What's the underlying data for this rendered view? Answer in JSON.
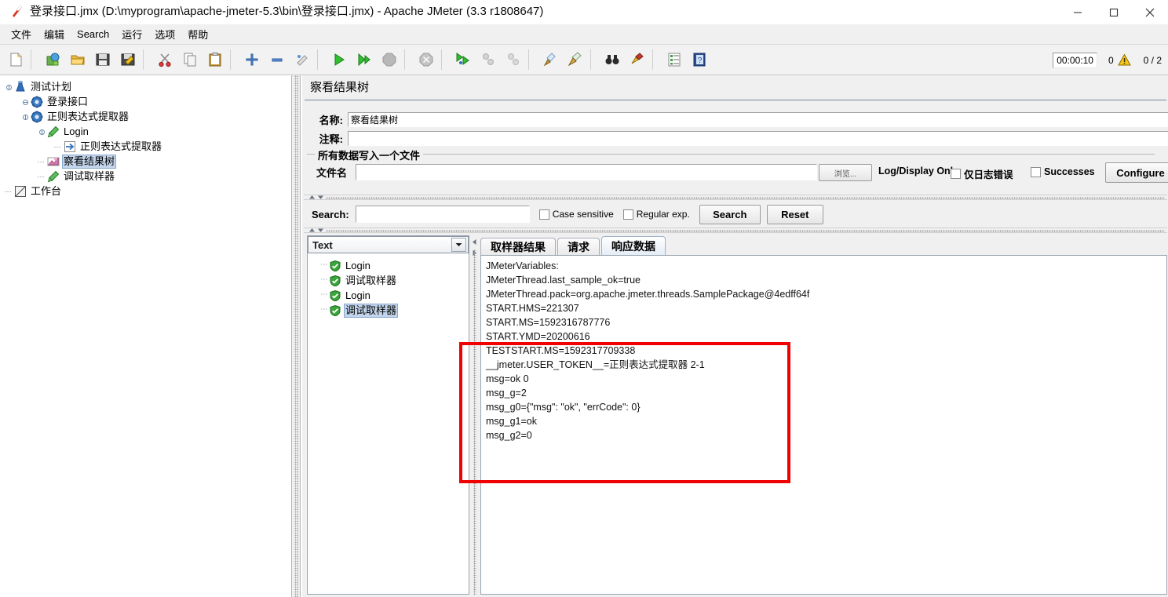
{
  "window": {
    "title": "登录接口.jmx (D:\\myprogram\\apache-jmeter-5.3\\bin\\登录接口.jmx) - Apache JMeter (3.3 r1808647)",
    "minimize_label": "—",
    "maximize_label": "□",
    "close_label": "✕",
    "app_icon": "jmeter-feather-icon"
  },
  "menu": {
    "items": [
      {
        "label": "文件",
        "name": "menu-file"
      },
      {
        "label": "编辑",
        "name": "menu-edit"
      },
      {
        "label": "Search",
        "name": "menu-search"
      },
      {
        "label": "运行",
        "name": "menu-run"
      },
      {
        "label": "选项",
        "name": "menu-options"
      },
      {
        "label": "帮助",
        "name": "menu-help"
      }
    ]
  },
  "toolbar": {
    "buttons": [
      {
        "icon": "new-document-icon",
        "name": "toolbar-new"
      },
      {
        "icon": "templates-icon",
        "name": "toolbar-templates"
      },
      {
        "icon": "open-folder-icon",
        "name": "toolbar-open"
      },
      {
        "icon": "save-icon",
        "name": "toolbar-save"
      },
      {
        "icon": "save-as-icon",
        "name": "toolbar-save-as"
      },
      {
        "icon": "cut-scissors-icon",
        "name": "toolbar-cut"
      },
      {
        "icon": "copy-icon",
        "name": "toolbar-copy"
      },
      {
        "icon": "paste-clipboard-icon",
        "name": "toolbar-paste"
      },
      {
        "icon": "expand-plus-icon",
        "name": "toolbar-expand-all"
      },
      {
        "icon": "collapse-minus-icon",
        "name": "toolbar-collapse-all"
      },
      {
        "icon": "toggle-icon",
        "name": "toolbar-toggle"
      },
      {
        "icon": "start-play-icon",
        "name": "toolbar-start"
      },
      {
        "icon": "start-no-timers-icon",
        "name": "toolbar-start-no-pauses"
      },
      {
        "icon": "stop-icon",
        "name": "toolbar-stop"
      },
      {
        "icon": "shutdown-icon",
        "name": "toolbar-shutdown"
      },
      {
        "icon": "remote-start-all-icon",
        "name": "toolbar-remote-start-all"
      },
      {
        "icon": "remote-stop-all-icon",
        "name": "toolbar-remote-stop-all"
      },
      {
        "icon": "remote-shutdown-all-icon",
        "name": "toolbar-remote-shutdown-all"
      },
      {
        "icon": "clear-broom-icon",
        "name": "toolbar-clear"
      },
      {
        "icon": "clear-all-broom-icon",
        "name": "toolbar-clear-all"
      },
      {
        "icon": "search-binoculars-icon",
        "name": "toolbar-search"
      },
      {
        "icon": "reset-search-brush-icon",
        "name": "toolbar-reset-search"
      },
      {
        "icon": "function-helper-icon",
        "name": "toolbar-function-helper"
      },
      {
        "icon": "help-book-icon",
        "name": "toolbar-help"
      }
    ],
    "status": {
      "timer": "00:00:10",
      "warning_count": "0",
      "warning_icon": "warning-triangle-icon",
      "thread_count": "0 / 2"
    }
  },
  "tree": {
    "nodes": [
      {
        "label": "测试计划",
        "icon": "test-plan-icon",
        "depth": 0,
        "handle": "expanded",
        "selected": false,
        "name": "tree-node-test-plan"
      },
      {
        "label": "登录接口",
        "icon": "thread-group-icon",
        "depth": 1,
        "handle": "collapsed",
        "selected": false,
        "name": "tree-node-login-interface"
      },
      {
        "label": "正则表达式提取器",
        "icon": "thread-group-icon",
        "depth": 1,
        "handle": "expanded",
        "selected": false,
        "name": "tree-node-regex-extractor-group"
      },
      {
        "label": "Login",
        "icon": "sampler-icon",
        "depth": 2,
        "handle": "expanded",
        "selected": false,
        "name": "tree-node-login-sampler"
      },
      {
        "label": "正则表达式提取器",
        "icon": "post-processor-icon",
        "depth": 3,
        "handle": "none",
        "selected": false,
        "name": "tree-node-regex-extractor"
      },
      {
        "label": "察看结果树",
        "icon": "view-results-tree-icon",
        "depth": 2,
        "handle": "none",
        "selected": true,
        "name": "tree-node-view-results-tree"
      },
      {
        "label": "调试取样器",
        "icon": "sampler-icon",
        "depth": 2,
        "handle": "none",
        "selected": false,
        "name": "tree-node-debug-sampler"
      },
      {
        "label": "工作台",
        "icon": "workbench-icon",
        "depth": 0,
        "handle": "none",
        "selected": false,
        "name": "tree-node-workbench"
      }
    ]
  },
  "panel": {
    "header": "察看结果树",
    "name_label": "名称:",
    "name_value": "察看结果树",
    "comment_label": "注释:",
    "comment_value": "",
    "groupbox_title": "所有数据写入一个文件",
    "filename_label": "文件名",
    "filename_value": "",
    "browse_label": "浏览...",
    "log_display_label": "Log/Display Only:",
    "errors_only_label": "仅日志错误",
    "successes_label": "Successes",
    "configure_label": "Configure"
  },
  "search": {
    "label": "Search:",
    "value": "",
    "case_sensitive_label": "Case sensitive",
    "regular_exp_label": "Regular exp.",
    "search_button": "Search",
    "reset_button": "Reset"
  },
  "results": {
    "render_selector": "Text",
    "items": [
      {
        "label": "Login",
        "status": "success",
        "selected": false,
        "name": "result-item-login-1"
      },
      {
        "label": "调试取样器",
        "status": "success",
        "selected": false,
        "name": "result-item-debug-1"
      },
      {
        "label": "Login",
        "status": "success",
        "selected": false,
        "name": "result-item-login-2"
      },
      {
        "label": "调试取样器",
        "status": "success",
        "selected": true,
        "name": "result-item-debug-2"
      }
    ]
  },
  "tabs": [
    {
      "label": "取样器结果",
      "active": false,
      "name": "tab-sampler-result"
    },
    {
      "label": "请求",
      "active": false,
      "name": "tab-request"
    },
    {
      "label": "响应数据",
      "active": true,
      "name": "tab-response-data"
    }
  ],
  "response_data": {
    "lines": [
      "JMeterVariables:",
      "JMeterThread.last_sample_ok=true",
      "JMeterThread.pack=org.apache.jmeter.threads.SamplePackage@4edff64f",
      "START.HMS=221307",
      "START.MS=1592316787776",
      "START.YMD=20200616",
      "TESTSTART.MS=1592317709338",
      "__jmeter.USER_TOKEN__=正则表达式提取器 2-1",
      "msg=ok 0",
      "msg_g=2",
      "msg_g0={\"msg\": \"ok\", \"errCode\": 0}",
      "msg_g1=ok",
      "msg_g2=0"
    ]
  },
  "annotation": {
    "highlight_color": "#f00000",
    "name": "red-highlight-box"
  }
}
